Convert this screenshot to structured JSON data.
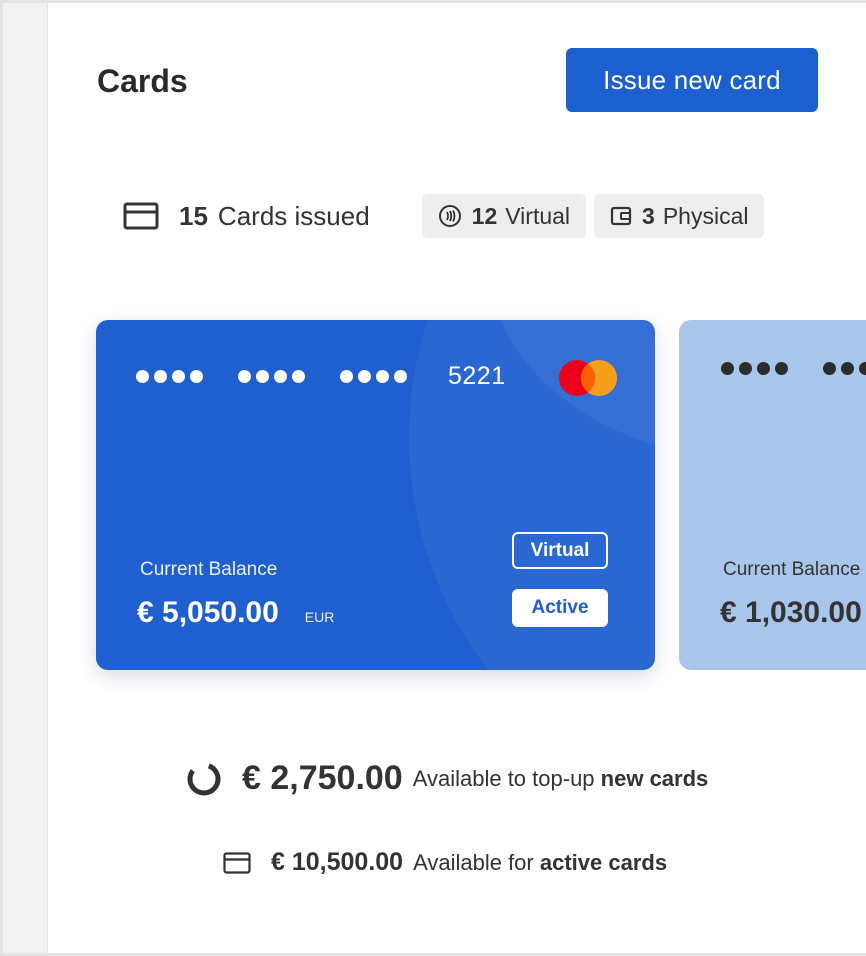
{
  "header": {
    "title": "Cards",
    "issue_button_label": "Issue new card"
  },
  "stats": {
    "issued_count": "15",
    "issued_label": "Cards issued",
    "virtual_count": "12",
    "virtual_label": "Virtual",
    "physical_count": "3",
    "physical_label": "Physical"
  },
  "cards": [
    {
      "masked_groups": [
        "●●●●",
        "●●●●",
        "●●●●"
      ],
      "last4": "5221",
      "balance_label": "Current Balance",
      "balance_amount": "€ 5,050.00",
      "currency": "EUR",
      "type_tag": "Virtual",
      "status_tag": "Active",
      "brand": "mastercard",
      "color": "#1f5fcf"
    },
    {
      "balance_label": "Current Balance",
      "balance_amount": "€ 1,030.00",
      "color": "#a8c6ea"
    }
  ],
  "summary": {
    "topup_amount": "€ 2,750.00",
    "topup_text": "Available to top-up",
    "topup_bold": "new cards",
    "active_amount": "€ 10,500.00",
    "active_text": "Available for",
    "active_bold": "active cards"
  },
  "colors": {
    "accent": "#1b5fd1",
    "mastercard_red": "#eb001b",
    "mastercard_orange": "#f79e1b"
  },
  "icons": [
    "credit-card-icon",
    "contactless-icon",
    "wallet-icon",
    "mastercard-logo",
    "progress-ring-icon"
  ]
}
